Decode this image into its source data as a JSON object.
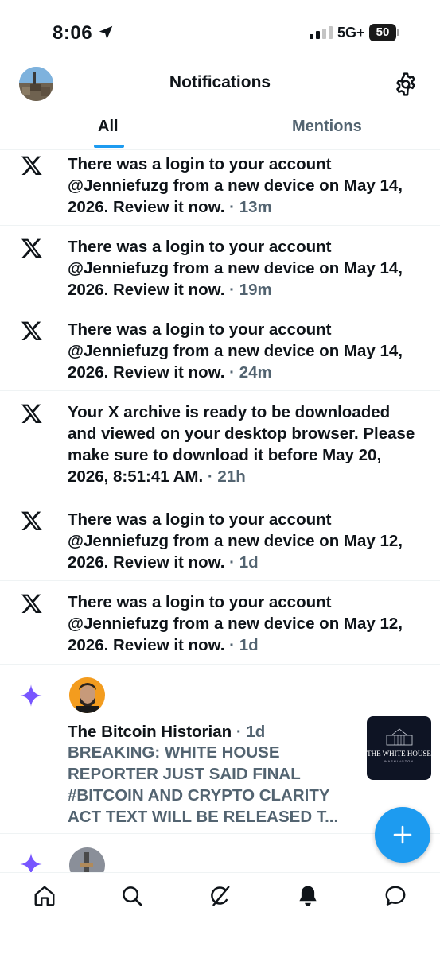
{
  "status_bar": {
    "time": "8:06",
    "network": "5G+",
    "battery": "50"
  },
  "header": {
    "title": "Notifications"
  },
  "tabs": [
    {
      "label": "All",
      "selected": true
    },
    {
      "label": "Mentions",
      "selected": false
    }
  ],
  "notifications": [
    {
      "icon": "x-logo-icon",
      "text": "There was a login to your account @Jenniefuzg from a new device on May 14, 2026. Review it now.",
      "time": " · 13m"
    },
    {
      "icon": "x-logo-icon",
      "text": "There was a login to your account @Jenniefuzg from a new device on May 14, 2026. Review it now.",
      "time": " · 19m"
    },
    {
      "icon": "x-logo-icon",
      "text": "There was a login to your account @Jenniefuzg from a new device on May 14, 2026. Review it now.",
      "time": " · 24m"
    },
    {
      "icon": "x-logo-icon",
      "text": "Your X archive is ready to be downloaded and viewed on your desktop browser. Please make sure to download it before May 20, 2026, 8:51:41 AM.",
      "time": " · 21h"
    },
    {
      "icon": "x-logo-icon",
      "text": "There was a login to your account @Jenniefuzg from a new device on May 12, 2026. Review it now.",
      "time": " · 1d"
    },
    {
      "icon": "x-logo-icon",
      "text": "There was a login to your account @Jenniefuzg from a new device on May 12, 2026. Review it now.",
      "time": " · 1d"
    }
  ],
  "post_notification": {
    "icon": "sparkle-icon",
    "author": "The Bitcoin Historian",
    "time": " · 1d",
    "body": "BREAKING: WHITE HOUSE REPORTER JUST SAID FINAL #BITCOIN AND CRYPTO CLARITY ACT TEXT WILL BE RELEASED T...",
    "thumbnail": {
      "title": "THE WHITE HOUSE",
      "subtitle": "WASHINGTON"
    }
  },
  "colors": {
    "accent": "#1d9bf0",
    "sparkle": "#7856ff",
    "secondary_text": "#536471"
  },
  "bottom_nav": [
    {
      "icon": "home-icon"
    },
    {
      "icon": "search-icon"
    },
    {
      "icon": "grok-icon"
    },
    {
      "icon": "notifications-bell-icon",
      "active": true
    },
    {
      "icon": "messages-icon"
    }
  ]
}
